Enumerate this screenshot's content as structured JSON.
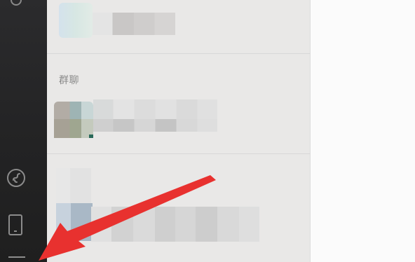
{
  "sidebar": {
    "icons": [
      "settings-icon",
      "mini-program-icon",
      "phone-icon",
      "menu-icon"
    ]
  },
  "contact_list": {
    "group_chat_section_title": "群聊"
  },
  "annotation": {
    "arrow_color": "#e8312f"
  },
  "colors": {
    "sidebar_bg": "#262627",
    "panel_bg": "#e9e8e7",
    "main_bg": "#fbfbfb"
  }
}
